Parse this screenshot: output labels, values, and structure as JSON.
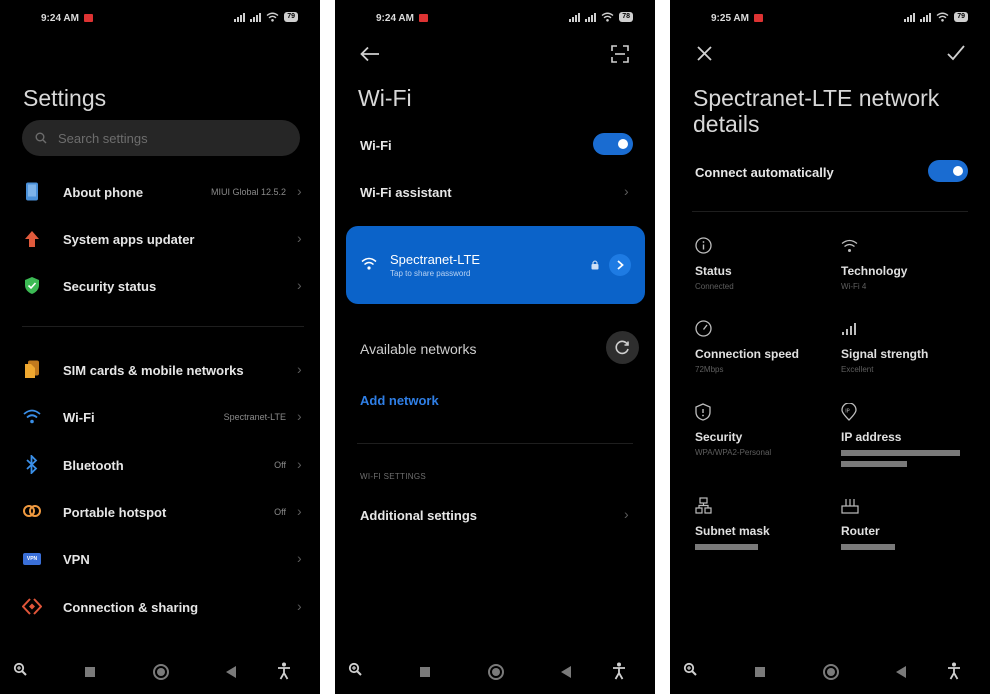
{
  "screen1": {
    "time": "9:24 AM",
    "battery": "79",
    "title": "Settings",
    "search_placeholder": "Search settings",
    "items": [
      {
        "label": "About phone",
        "value": "MIUI Global 12.5.2",
        "icon": "phone-icon",
        "color": "#4a90d9"
      },
      {
        "label": "System apps updater",
        "value": "",
        "icon": "up-arrow-icon",
        "color": "#e05a3c"
      },
      {
        "label": "Security status",
        "value": "",
        "icon": "shield-check-icon",
        "color": "#3cba54"
      },
      {
        "label": "SIM cards & mobile networks",
        "value": "",
        "icon": "sim-card-icon",
        "color": "#f0a830"
      },
      {
        "label": "Wi-Fi",
        "value": "Spectranet-LTE",
        "icon": "wifi-icon",
        "color": "#3a8fe8"
      },
      {
        "label": "Bluetooth",
        "value": "Off",
        "icon": "bluetooth-icon",
        "color": "#3a8fe8"
      },
      {
        "label": "Portable hotspot",
        "value": "Off",
        "icon": "hotspot-icon",
        "color": "#f09a40"
      },
      {
        "label": "VPN",
        "value": "",
        "icon": "vpn-icon",
        "color": "#3a6fd8"
      },
      {
        "label": "Connection & sharing",
        "value": "",
        "icon": "connection-sharing-icon",
        "color": "#e2563a"
      }
    ]
  },
  "screen2": {
    "time": "9:24 AM",
    "battery": "78",
    "title": "Wi-Fi",
    "wifi_label": "Wi-Fi",
    "wifi_assistant": "Wi-Fi assistant",
    "network_name": "Spectranet-LTE",
    "network_sub": "Tap to share password",
    "available_networks": "Available networks",
    "add_network": "Add network",
    "settings_head": "WI-FI SETTINGS",
    "additional_settings": "Additional settings"
  },
  "screen3": {
    "time": "9:25 AM",
    "battery": "79",
    "title_line1": "Spectranet-LTE network",
    "title_line2": "details",
    "connect_auto": "Connect automatically",
    "details": [
      {
        "label": "Status",
        "value": "Connected",
        "icon": "info-icon"
      },
      {
        "label": "Technology",
        "value": "Wi-Fi 4",
        "icon": "wifi-icon"
      },
      {
        "label": "Connection speed",
        "value": "72Mbps",
        "icon": "speedometer-icon"
      },
      {
        "label": "Signal strength",
        "value": "Excellent",
        "icon": "signal-icon"
      },
      {
        "label": "Security",
        "value": "WPA/WPA2-Personal",
        "icon": "shield-icon"
      },
      {
        "label": "IP address",
        "value": "",
        "icon": "ip-pin-icon"
      },
      {
        "label": "Subnet mask",
        "value": "",
        "icon": "subnet-icon"
      },
      {
        "label": "Router",
        "value": "",
        "icon": "router-icon"
      }
    ]
  }
}
